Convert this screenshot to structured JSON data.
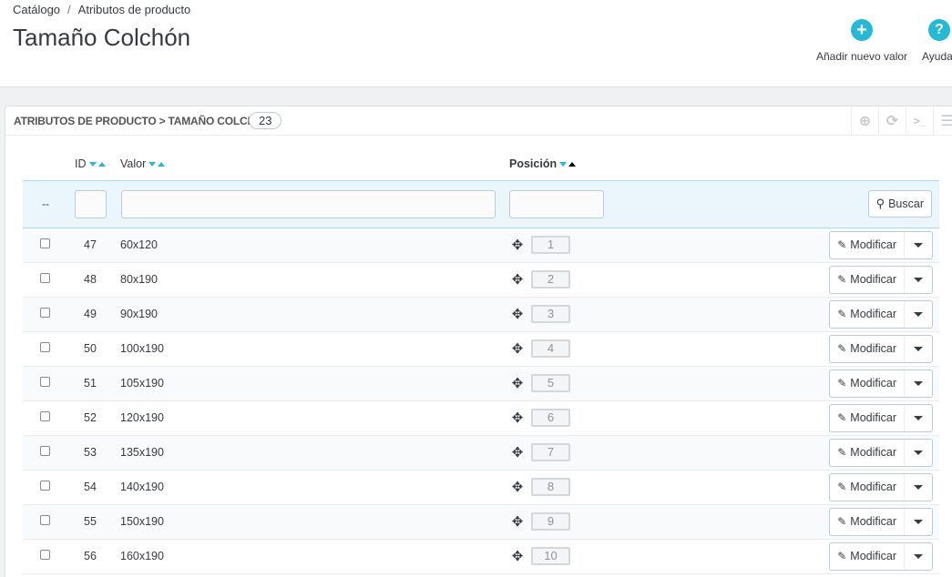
{
  "breadcrumb": {
    "parent": "Catálogo",
    "separator": "/",
    "current": "Atributos de producto"
  },
  "page_title": "Tamaño Colchón",
  "toolbar": {
    "add_label": "Añadir nuevo valor",
    "help_label": "Ayuda"
  },
  "panel": {
    "title": "ATRIBUTOS DE PRODUCTO > TAMAÑO COLCHÓN",
    "count": "23"
  },
  "columns": {
    "id": "ID",
    "value": "Valor",
    "position": "Posición"
  },
  "filters": {
    "bulk_placeholder": "--",
    "search_label": "Buscar"
  },
  "rows": [
    {
      "id": "47",
      "value": "60x120",
      "position": "1",
      "action": "Modificar"
    },
    {
      "id": "48",
      "value": "80x190",
      "position": "2",
      "action": "Modificar"
    },
    {
      "id": "49",
      "value": "90x190",
      "position": "3",
      "action": "Modificar"
    },
    {
      "id": "50",
      "value": "100x190",
      "position": "4",
      "action": "Modificar"
    },
    {
      "id": "51",
      "value": "105x190",
      "position": "5",
      "action": "Modificar"
    },
    {
      "id": "52",
      "value": "120x190",
      "position": "6",
      "action": "Modificar"
    },
    {
      "id": "53",
      "value": "135x190",
      "position": "7",
      "action": "Modificar"
    },
    {
      "id": "54",
      "value": "140x190",
      "position": "8",
      "action": "Modificar"
    },
    {
      "id": "55",
      "value": "150x190",
      "position": "9",
      "action": "Modificar"
    },
    {
      "id": "56",
      "value": "160x190",
      "position": "10",
      "action": "Modificar"
    }
  ],
  "colors": {
    "accent": "#25b9d7",
    "text": "#363a41",
    "filter_bg": "#eaf6fb"
  }
}
